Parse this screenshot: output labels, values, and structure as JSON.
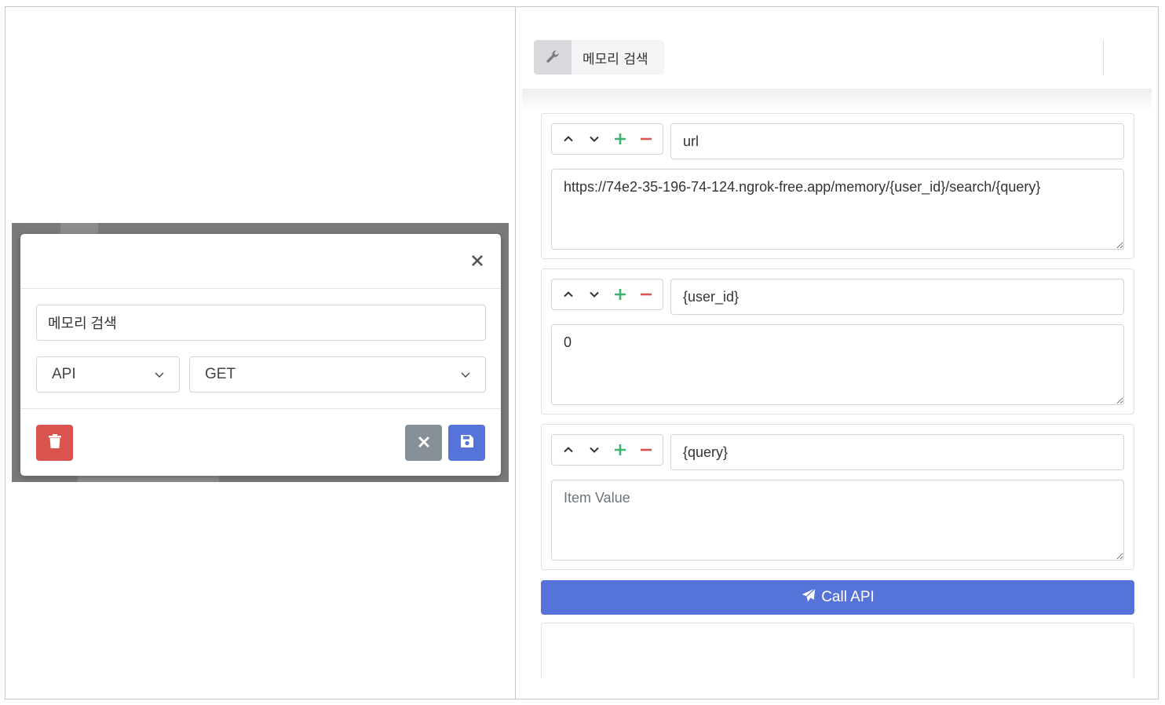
{
  "tool": {
    "label": "메모리 검색",
    "icon": "wrench-icon"
  },
  "params": [
    {
      "name": "url",
      "value": "https://74e2-35-196-74-124.ngrok-free.app/memory/{user_id}/search/{query}",
      "placeholder": "Item Value"
    },
    {
      "name": "{user_id}",
      "value": "0",
      "placeholder": "Item Value"
    },
    {
      "name": "{query}",
      "value": "",
      "placeholder": "Item Value"
    }
  ],
  "call_button": {
    "label": "Call API",
    "icon": "paper-plane-icon"
  },
  "modal": {
    "title_value": "메모리 검색",
    "type_select": "API",
    "method_select": "GET"
  },
  "colors": {
    "primary": "#5673d9",
    "danger": "#d9534f",
    "secondary": "#868e96",
    "plus": "#3cb371",
    "minus": "#d9534f"
  }
}
